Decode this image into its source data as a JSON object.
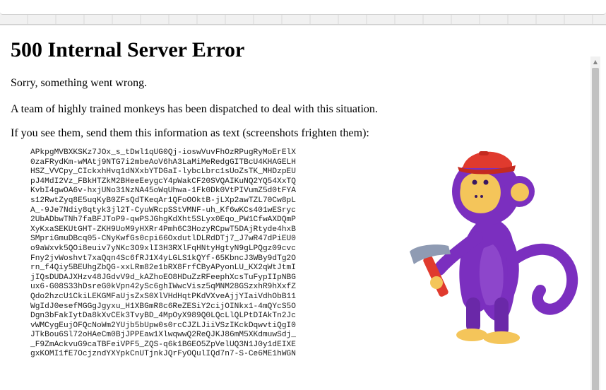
{
  "error": {
    "title": "500 Internal Server Error",
    "line1": "Sorry, something went wrong.",
    "line2": "A team of highly trained monkeys has been dispatched to deal with this situation.",
    "line3": "If you see them, send them this information as text (screenshots frighten them):",
    "debug_text": "APkpgMVBXKSKz7JOx_s_tDwl1qUG0Qj-ioswVuvFhOzRPugRyMoErElX\n0zaFRydKm-wMAtj9NTG7i2mbeAoV6hA3LaMiMeRedgGITBcU4KHAGELH\nHSZ_VVCpy_CIckxhHvq1dNXxbYTDGaI-lybcLbrc1sUoZsTK_MHDzpEU\npJ4MdI2Vz_FBkHTZkM2BHeeEeygcY4pWakCF20SVQAIKuNQ2YQ54XxTQ\nKvbI4gwOA6v-hxjUNo31NzNA45oWqUhwa-1Fk0Dk0VtPIVumZ5d0tFYA\ns12RwtZyq8E5uqKyB0ZFsQdTKeqAr1QFoOOktB-jLXp2awTZL70Cw8pL\nA_-9Je7Ndiy8qtyk3jl2T-CyuWRcpSStVMNF-uh_Kf6wKCs401wESryc\n2UbADbwTNh7faBFJToP9-qwPSJGhgKdXht5SLyx0Eqo_PW1CfwAXDQmP\nXyKxaSEKUtGHT-ZKH9UoM9yHXRr4Pmh6C3HozyRCpwT5DAjRtyde4hxB\nSMpriGmuDBcq05-CNyKwfGs0cpi66OxdutlDLRdDTj7_J7wR47dPiEU0\no9aWxvk5QOi8euiv7yNKc3O9xlI3H3RXlFqHNtyHgtyN9gLPQgz09cvc\nFny2jvWoshvt7xaQqn4Sc6fRJ1X4yLGLS1kQYf-65KbncJ3WBy9dTg2O\nrn_f4Qiy5BEUhgZbQG-xxLRm82e1bRX8FrfCByAPyonLU_KX2qWtJtmI\njIQsDUDAJXHzv48JGdvV9d_kAZhoEO8HDuZzRFeephXcsTuFypIIpNBG\nux6-G08S33hDsreG0kVpn42ySc6ghIWwcVisz5qMNM28GSzxhR9hXxfZ\nQdo2hzcU1CkiLEKGMFaUjsZxS0XlVHdHqtPKdVXveAjjYIaiVdhObB11\nWgIdJ0esefMGGgJgyxu_H1XBGmR8c6ReZESiY2cijOINkx1-4mQYcS5O\nDgn3bFakIytDa8kXvCEk3TvyBD_4MpOyX989Q0LQcLlQLPtDIAkTn2Jc\nvWMCygEujOFQcNoWm2YUjb5bUpw0s0rcCJZLJiiVSzIKckDqwvtiQgI0\nJTkBou6Sl72oHAeCm0BjJPPEaw1XlwqwwQ2ReQJKJ86mM5XKdmuwSdj_\n_F9ZmAckvuG9caTBFeiVPF5_ZQS-q6k1BGEO5ZpVelUQ3N1J0y1dEIXE\ngxKOMI1fE7OcjzndYXYpkCnUTjnkJQrFyOQulIQd7n7-S-Ce6ME1hWGN"
  },
  "icons": {
    "monkey": "monkey-with-hammer-illustration",
    "scroll_up": "scroll-up-arrow-icon",
    "scroll_down": "scroll-down-arrow-icon"
  },
  "colors": {
    "monkey_body": "#7b2fbf",
    "monkey_face": "#f4c55a",
    "hat": "#e03a2e",
    "hammer_head": "#8f9bb3"
  }
}
